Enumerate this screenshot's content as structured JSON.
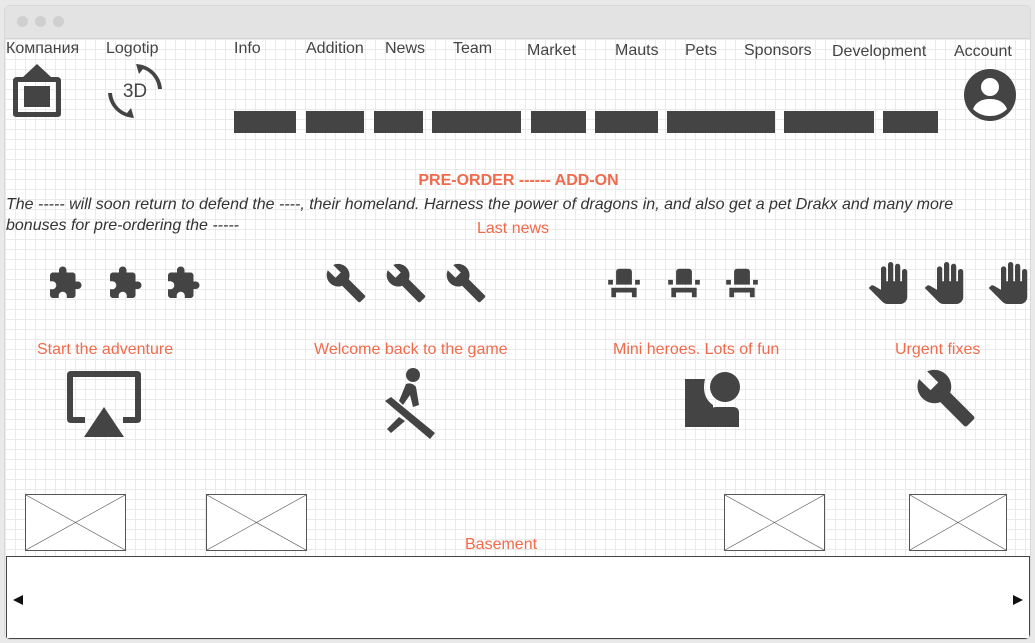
{
  "nav": {
    "company": "Компания",
    "logotip": "Logotip",
    "logo_badge": "3D",
    "items": [
      {
        "label": "Info"
      },
      {
        "label": "Addition"
      },
      {
        "label": "News"
      },
      {
        "label": "Team"
      },
      {
        "label": "Market"
      },
      {
        "label": "Mauts"
      },
      {
        "label": "Pets"
      },
      {
        "label": "Sponsors"
      },
      {
        "label": "Development"
      }
    ],
    "account": "Account"
  },
  "promo": {
    "headline": "PRE-ORDER ------ ADD-ON",
    "text": "The ----- will soon return to defend the ----, their homeland. Harness the power of dragons in, and also get a pet Drakx and many more bonuses for pre-ordering the -----"
  },
  "news": {
    "title": "Last news",
    "icon_groups": [
      {
        "icon": "puzzle-icon",
        "count": 3
      },
      {
        "icon": "wrench-icon",
        "count": 3
      },
      {
        "icon": "seat-icon",
        "count": 3
      },
      {
        "icon": "hand-icon",
        "count": 3
      }
    ],
    "cards": [
      {
        "title": "Start the adventure",
        "icon": "airplay-icon"
      },
      {
        "title": "Welcome back to the game",
        "icon": "rowing-icon"
      },
      {
        "title": "Mini heroes. Lots of fun",
        "icon": "shapes-person-icon"
      },
      {
        "title": "Urgent fixes",
        "icon": "wrench-icon"
      }
    ]
  },
  "footer": {
    "title": "Basement"
  },
  "colors": {
    "accent": "#f26a4b",
    "icon": "#444444",
    "grid": "#eaeaea"
  }
}
